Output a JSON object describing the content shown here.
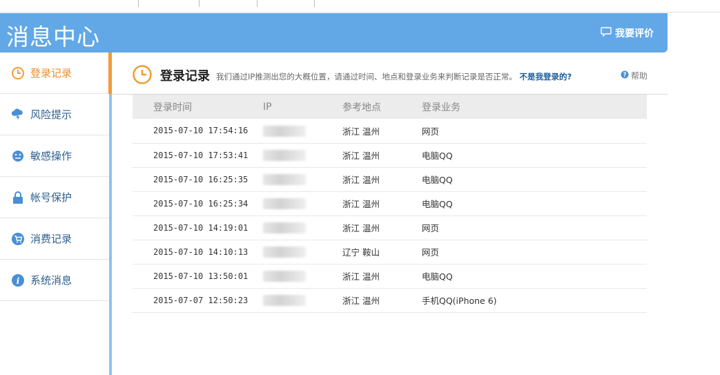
{
  "header": {
    "title": "消息中心",
    "feedback_label": "我要评价"
  },
  "sidebar": {
    "items": [
      {
        "label": "登录记录",
        "icon": "clock-icon"
      },
      {
        "label": "风险提示",
        "icon": "cloud-lightning-icon"
      },
      {
        "label": "敏感操作",
        "icon": "face-icon"
      },
      {
        "label": "帐号保护",
        "icon": "lock-icon"
      },
      {
        "label": "消费记录",
        "icon": "cart-icon"
      },
      {
        "label": "系统消息",
        "icon": "info-icon"
      }
    ]
  },
  "content": {
    "title": "登录记录",
    "description": "我们通过IP推测出您的大概位置，请通过时间、地点和登录业务来判断记录是否正常。",
    "not_me_link": "不是我登录的?",
    "help_label": "帮助"
  },
  "table": {
    "headers": [
      "登录时间",
      "IP",
      "参考地点",
      "登录业务"
    ],
    "rows": [
      {
        "time": "2015-07-10 17:54:16",
        "location": "浙江 温州",
        "service": "网页"
      },
      {
        "time": "2015-07-10 17:53:41",
        "location": "浙江 温州",
        "service": "电脑QQ"
      },
      {
        "time": "2015-07-10 16:25:35",
        "location": "浙江 温州",
        "service": "电脑QQ"
      },
      {
        "time": "2015-07-10 16:25:34",
        "location": "浙江 温州",
        "service": "电脑QQ"
      },
      {
        "time": "2015-07-10 14:19:01",
        "location": "浙江 温州",
        "service": "网页"
      },
      {
        "time": "2015-07-10 14:10:13",
        "location": "辽宁 鞍山",
        "service": "网页"
      },
      {
        "time": "2015-07-10 13:50:01",
        "location": "浙江 温州",
        "service": "电脑QQ"
      },
      {
        "time": "2015-07-07 12:50:23",
        "location": "浙江 温州",
        "service": "手机QQ(iPhone 6)"
      }
    ]
  },
  "colors": {
    "header_bg": "#63a8e6",
    "active_accent": "#f19a38",
    "link": "#1b5e9a"
  }
}
